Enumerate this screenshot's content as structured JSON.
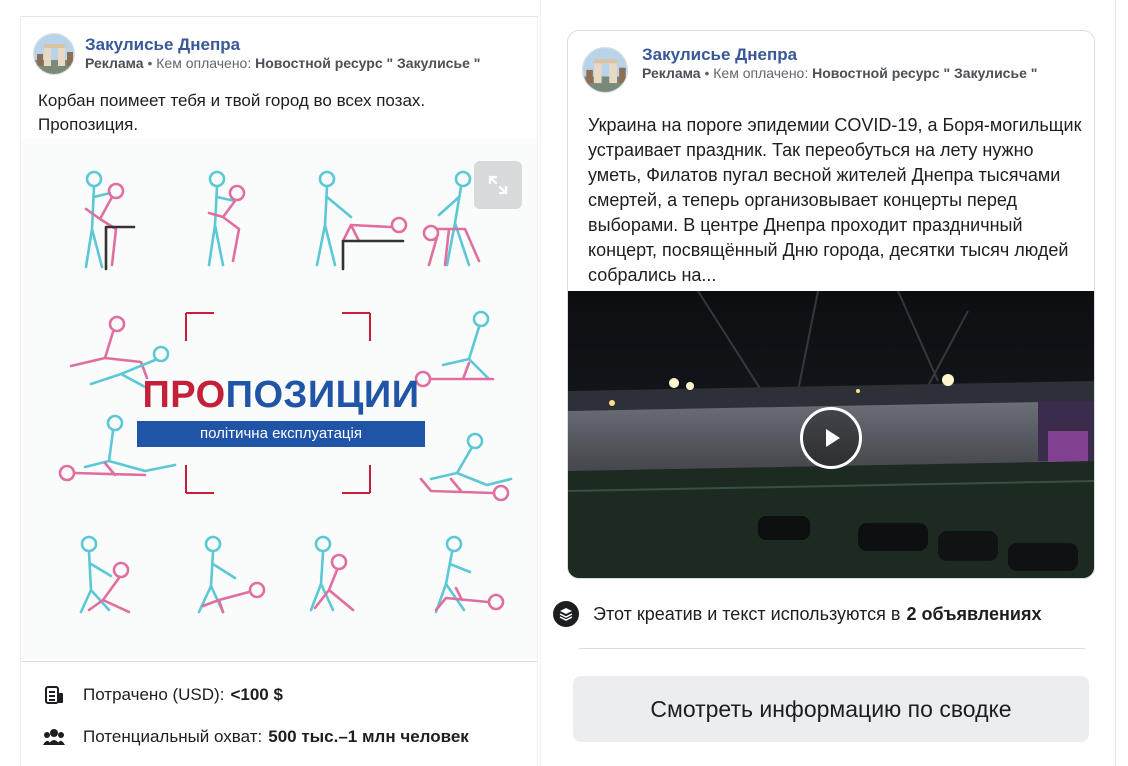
{
  "left_ad": {
    "page_name": "Закулисье Днепра",
    "sponsored": "Реклама",
    "paid_by_label": " • Кем оплачено: ",
    "paid_by": "Новостной ресурс \" Закулисье \"",
    "text": "Корбан поимеет тебя и твой город во всех позах. Пропозиция.",
    "creative": {
      "title_red": "ПРО",
      "title_blue": "ПОЗИЦИИ",
      "subtitle": "політична експлуатація"
    },
    "spent_label": "Потрачено (USD):",
    "spent_value": "<100 $",
    "reach_label": "Потенциальный охват:",
    "reach_value": "500 тыс.–1 млн человек"
  },
  "right_ad": {
    "page_name": "Закулисье Днепра",
    "sponsored": "Реклама",
    "paid_by_label": " • Кем оплачено: ",
    "paid_by": "Новостной ресурс \" Закулисье \"",
    "text": "Украина на пороге эпидемии COVID-19, а Боря-могильщик устраивает праздник. Так переобуться на лету нужно уметь, Филатов пугал весной жителей Днепра тысячами смертей, а теперь организовывает концерты перед выборами. В центре Днепра проходит праздничный концерт, посвящённый Дню города, десятки тысяч людей собрались на...",
    "usage_text": "Этот креатив и текст используются в",
    "usage_count": "2 объявлениях",
    "summary_button": "Смотреть информацию по сводке"
  },
  "colors": {
    "link_blue": "#385898",
    "brand_red": "#c4203a",
    "brand_blue": "#1f54a6",
    "pose_pink": "#e06fa0",
    "pose_cyan": "#5cc8d6"
  },
  "icons": [
    "expand-icon",
    "coins-icon",
    "people-icon",
    "layers-icon",
    "play-icon"
  ]
}
